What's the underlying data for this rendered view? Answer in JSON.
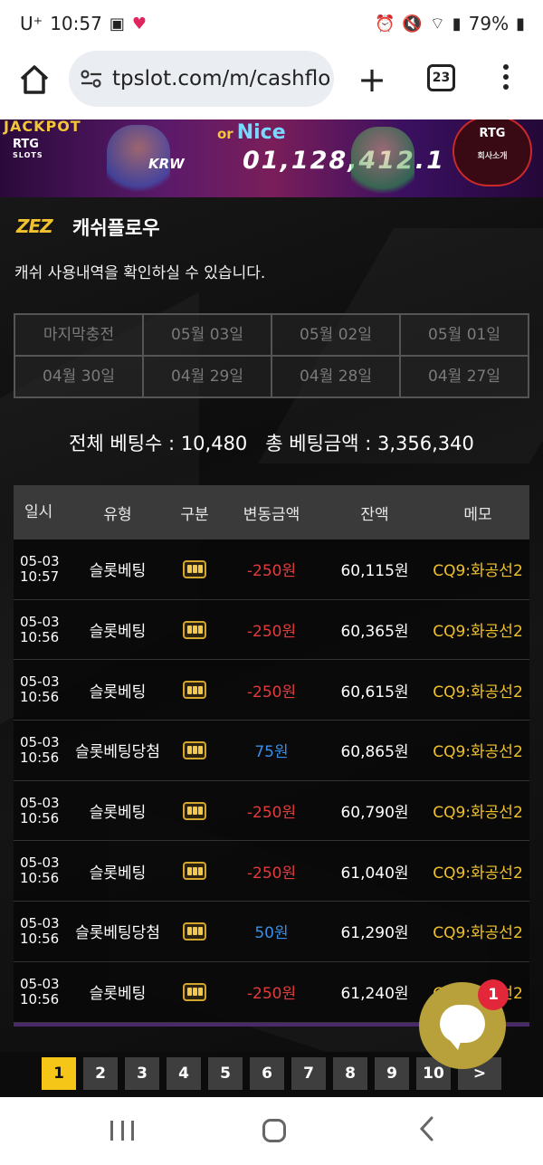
{
  "status_bar": {
    "carrier": "U⁺",
    "time": "10:57",
    "battery": "79%"
  },
  "browser": {
    "url": "tpslot.com/m/cashflo",
    "tab_count": "23"
  },
  "banner": {
    "jackpot_label": "JACKPOT",
    "provider_logo": "RTG",
    "provider_sub": "SLOTS",
    "promo_or": "or",
    "promo_title": "Nice",
    "currency": "KRW",
    "jackpot_amount": "01,128,412.1",
    "badge_title": "RTG",
    "badge_sub": "회사소개"
  },
  "page": {
    "logo_text": "ZEZ",
    "title": "캐쉬플로우",
    "subtitle": "캐쉬 사용내역을 확인하실 수 있습니다."
  },
  "date_filters": [
    "마지막충전",
    "05월 03일",
    "05월 02일",
    "05월 01일",
    "04월 30일",
    "04월 29일",
    "04월 28일",
    "04월 27일"
  ],
  "summary": {
    "bet_count_label": "전체 베팅수",
    "bet_count": "10,480",
    "bet_amount_label": "총 베팅금액",
    "bet_amount": "3,356,340"
  },
  "table": {
    "headers": [
      "일시",
      "유형",
      "구분",
      "변동금액",
      "잔액",
      "메모"
    ],
    "rows": [
      {
        "date": "05-03",
        "time": "10:57",
        "type": "슬롯베팅",
        "change": "-250원",
        "balance": "60,115원",
        "memo": "CQ9:화공선2"
      },
      {
        "date": "05-03",
        "time": "10:56",
        "type": "슬롯베팅",
        "change": "-250원",
        "balance": "60,365원",
        "memo": "CQ9:화공선2"
      },
      {
        "date": "05-03",
        "time": "10:56",
        "type": "슬롯베팅",
        "change": "-250원",
        "balance": "60,615원",
        "memo": "CQ9:화공선2"
      },
      {
        "date": "05-03",
        "time": "10:56",
        "type": "슬롯베팅당첨",
        "change": "75원",
        "balance": "60,865원",
        "memo": "CQ9:화공선2"
      },
      {
        "date": "05-03",
        "time": "10:56",
        "type": "슬롯베팅",
        "change": "-250원",
        "balance": "60,790원",
        "memo": "CQ9:화공선2"
      },
      {
        "date": "05-03",
        "time": "10:56",
        "type": "슬롯베팅",
        "change": "-250원",
        "balance": "61,040원",
        "memo": "CQ9:화공선2"
      },
      {
        "date": "05-03",
        "time": "10:56",
        "type": "슬롯베팅당첨",
        "change": "50원",
        "balance": "61,290원",
        "memo": "CQ9:화공선2"
      },
      {
        "date": "05-03",
        "time": "10:56",
        "type": "슬롯베팅",
        "change": "-250원",
        "balance": "61,240원",
        "memo": "CQ9:화공선2"
      }
    ]
  },
  "pagination": {
    "pages": [
      "1",
      "2",
      "3",
      "4",
      "5",
      "6",
      "7",
      "8",
      "9",
      "10"
    ],
    "current": "1",
    "next_label": ">"
  },
  "chat": {
    "badge_count": "1"
  },
  "colors": {
    "accent": "#f5c518",
    "negative": "#e23b3b",
    "positive": "#3a8ee8",
    "memo": "#f0c02a"
  }
}
